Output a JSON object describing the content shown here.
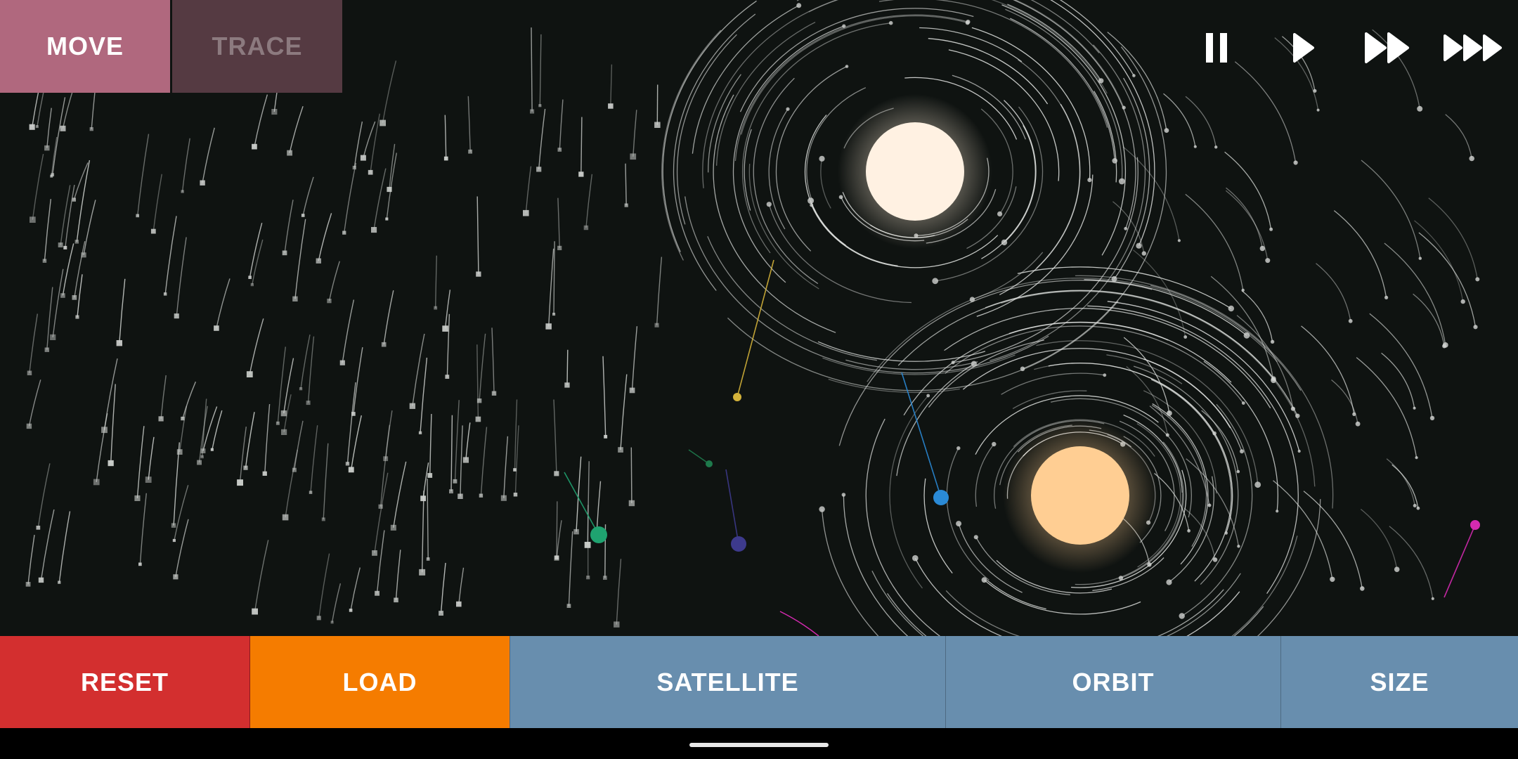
{
  "toolbar": {
    "move_label": "MOVE",
    "trace_label": "TRACE"
  },
  "speed_controls": [
    {
      "name": "pause-icon",
      "label": ""
    },
    {
      "name": "play-icon",
      "label": ""
    },
    {
      "name": "fast-forward-icon",
      "label": ""
    },
    {
      "name": "fastest-forward-icon",
      "label": ""
    }
  ],
  "actions": {
    "reset_label": "RESET",
    "load_label": "LOAD",
    "satellite_label": "SATELLITE",
    "orbit_label": "ORBIT",
    "size_label": "SIZE"
  },
  "colors": {
    "space_background": "#0f1311",
    "move_active": "#b0687e",
    "trace_inactive": "#553a42",
    "trace_text": "#8c7a7f",
    "reset": "#d32f2f",
    "load": "#f57c00",
    "satellite": "#688eae",
    "orbit": "#688eae",
    "size": "#688eae",
    "star_primary": "#fff1e2",
    "star_secondary": "#ffce93",
    "planet_yellow": "#d4b33a",
    "planet_green": "#1fa370",
    "planet_dark_green": "#1e7a4c",
    "planet_indigo": "#3d3a8c",
    "planet_blue": "#2a8ad6",
    "planet_magenta": "#d42ab0"
  }
}
